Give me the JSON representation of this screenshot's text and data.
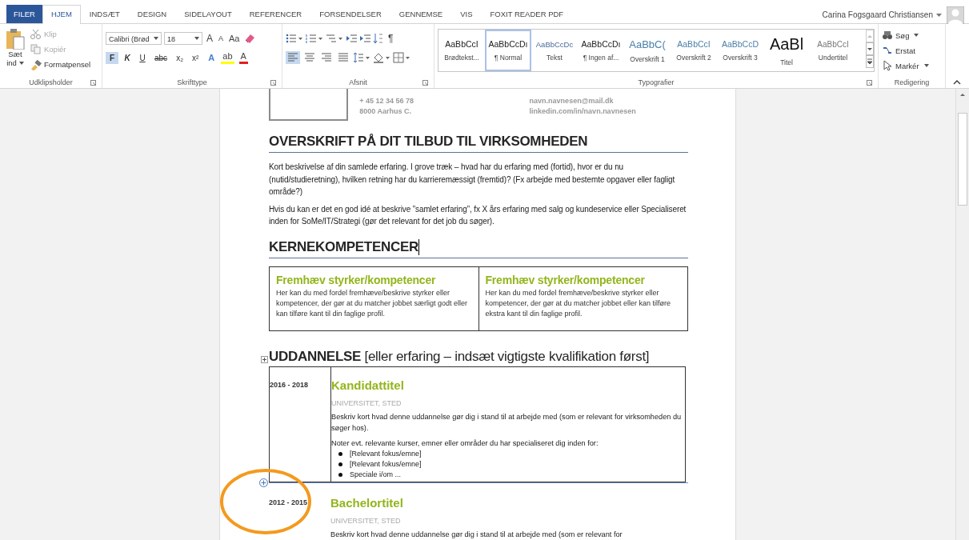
{
  "tabs": [
    {
      "label": "FILER",
      "kind": "file",
      "selected": false
    },
    {
      "label": "HJEM",
      "kind": "tab",
      "selected": true
    },
    {
      "label": "INDSÆT",
      "kind": "tab",
      "selected": false
    },
    {
      "label": "DESIGN",
      "kind": "tab",
      "selected": false
    },
    {
      "label": "SIDELAYOUT",
      "kind": "tab",
      "selected": false
    },
    {
      "label": "REFERENCER",
      "kind": "tab",
      "selected": false
    },
    {
      "label": "FORSENDELSER",
      "kind": "tab",
      "selected": false
    },
    {
      "label": "GENNEMSE",
      "kind": "tab",
      "selected": false
    },
    {
      "label": "VIS",
      "kind": "tab",
      "selected": false
    },
    {
      "label": "FOXIT READER PDF",
      "kind": "tab",
      "selected": false
    }
  ],
  "user": {
    "name": "Carina Fogsgaard Christiansen"
  },
  "clipboard": {
    "label": "Udklipsholder",
    "paste_label": "Sæt",
    "paste_sub": "ind",
    "items": [
      {
        "label": "Klip",
        "kind": "cut",
        "disabled": true
      },
      {
        "label": "Kopiér",
        "kind": "copy",
        "disabled": true
      },
      {
        "label": "Formatpensel",
        "kind": "painter",
        "disabled": false
      }
    ]
  },
  "font": {
    "label": "Skrifttype",
    "font_name": "Calibri (Brød",
    "font_size": "18",
    "grow": "A",
    "shrink": "A",
    "case": "Aa",
    "format_buttons": [
      {
        "label": "F",
        "kind": "bold",
        "selected": true
      },
      {
        "label": "K",
        "kind": "italic",
        "selected": false
      },
      {
        "label": "U",
        "kind": "underline",
        "selected": false
      },
      {
        "label": "abc",
        "kind": "strike",
        "selected": false
      },
      {
        "label": "x₂",
        "kind": "sub",
        "selected": false
      },
      {
        "label": "x²",
        "kind": "sup",
        "selected": false
      }
    ],
    "color_buttons": [
      {
        "label": "A",
        "kind": "effects",
        "color": "#4a7fd0"
      },
      {
        "label": "ab",
        "kind": "highlight",
        "color": "#ffff00"
      },
      {
        "label": "A",
        "kind": "fontcolor",
        "color": "#e02020"
      }
    ]
  },
  "paragraph": {
    "label": "Afsnit",
    "pilcrow": "¶",
    "alignments": [
      {
        "kind": "left",
        "selected": true
      },
      {
        "kind": "center",
        "selected": false
      },
      {
        "kind": "right",
        "selected": false
      },
      {
        "kind": "justify",
        "selected": false
      }
    ]
  },
  "styles": {
    "label": "Typografier",
    "items": [
      {
        "preview": "AaBbCcI",
        "label": "Brødtekst...",
        "kind": "body",
        "selected": false
      },
      {
        "preview": "AaBbCcDı",
        "label": "¶ Normal",
        "kind": "body",
        "selected": true
      },
      {
        "preview": "AaBbCcDc",
        "label": "Tekst",
        "kind": "accent",
        "selected": false
      },
      {
        "preview": "AaBbCcDı",
        "label": "¶ Ingen af...",
        "kind": "body",
        "selected": false
      },
      {
        "preview": "AaBbC(",
        "label": "Overskrift 1",
        "kind": "heading1",
        "selected": false
      },
      {
        "preview": "AaBbCcI",
        "label": "Overskrift 2",
        "kind": "heading2",
        "selected": false
      },
      {
        "preview": "AaBbCcD",
        "label": "Overskrift 3",
        "kind": "heading3",
        "selected": false
      },
      {
        "preview": "AaBl",
        "label": "Titel",
        "kind": "title",
        "selected": false
      },
      {
        "preview": "AaBbCcI",
        "label": "Undertitel",
        "kind": "subtitle",
        "selected": false
      }
    ]
  },
  "editing": {
    "label": "Redigering",
    "items": [
      {
        "label": "Søg",
        "kind": "find"
      },
      {
        "label": "Erstat",
        "kind": "replace"
      },
      {
        "label": "Markér",
        "kind": "select"
      }
    ]
  },
  "document": {
    "contact_columns": [
      [
        "+ 45 12 34 56 78",
        "8000 Aarhus C."
      ],
      [
        "navn.navnesen@mail.dk",
        "linkedin.com/in/navn.navnesen"
      ]
    ],
    "intro": {
      "heading": "OVERSKRIFT PÅ DIT TILBUD TIL VIRKSOMHEDEN",
      "paragraphs": [
        "Kort beskrivelse af din samlede erfaring. I grove træk – hvad har du erfaring med (fortid), hvor er du nu (nutid/studieretning), hvilken retning har du karrieremæssigt (fremtid)? (Fx arbejde med bestemte opgaver eller fagligt område?)",
        "Hvis du kan er det en god idé at beskrive ”samlet erfaring”, fx X års erfaring med salg og kundeservice eller Specialiseret inden for SoMe/IT/Strategi (gør det relevant for det job du søger)."
      ]
    },
    "competences": {
      "heading": "KERNEKOMPETENCER",
      "cursor": true,
      "cells": [
        {
          "title": "Fremhæv styrker/kompetencer",
          "text": "Her kan du med fordel fremhæve/beskrive styrker eller kompetencer, der gør at du matcher jobbet særligt godt eller kan tilføre kant til din faglige profil."
        },
        {
          "title": "Fremhæv styrker/kompetencer",
          "text": "Her kan du med fordel fremhæve/beskrive styrker eller kompetencer, der gør at du matcher jobbet eller kan tilføre ekstra kant til din faglige profil."
        }
      ]
    },
    "education": {
      "heading": "**UDDANNELSE** [eller erfaring – indsæt vigtigste kvalifikation først]",
      "entries": [
        {
          "years": "2016 - 2018",
          "title": "Kandidattitel",
          "place": "UNIVERSITET, STED",
          "text": "Beskriv kort hvad denne uddannelse gør dig i stand til at arbejde med (som er relevant for virksomheden du søger hos).",
          "note": "Noter evt. relevante kurser, emner eller områder du har specialiseret dig inden for:",
          "bullets": [
            "[Relevant fokus/emne]",
            "[Relevant fokus/emne]",
            "Speciale i/om ..."
          ],
          "bordered": true
        },
        {
          "years": "2012 - 2015",
          "title": "Bachelortitel",
          "place": "UNIVERSITET, STED",
          "text": "Beskriv kort hvad denne uddannelse gør dig i stand til at arbejde med (som er relevant for",
          "bordered": false
        }
      ]
    }
  },
  "annotations": [
    {
      "kind": "ellipse"
    }
  ]
}
